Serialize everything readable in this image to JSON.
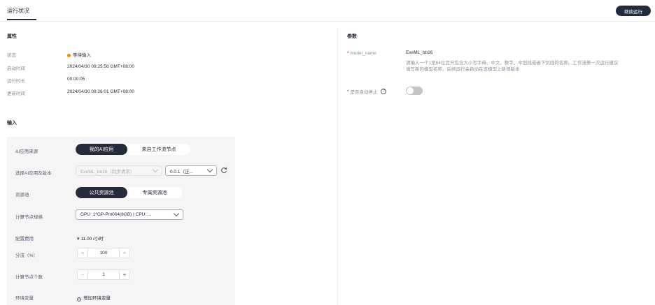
{
  "header": {
    "tab": "运行状况",
    "continue_button": "继续运行"
  },
  "properties": {
    "title": "属性",
    "rows": [
      {
        "label": "状态",
        "value": "等待输入"
      },
      {
        "label": "启动时间",
        "value": "2024/04/30 09:25:56 GMT+08:00"
      },
      {
        "label": "运行时长",
        "value": "00:00:05"
      },
      {
        "label": "更新时间",
        "value": "2024/04/30 09:26:01 GMT+08:00"
      }
    ],
    "status_color": "#ff8800"
  },
  "input": {
    "title": "输入",
    "ai_source": {
      "label": "AI应用来源",
      "options": [
        "我的AI应用",
        "来自工作流节点"
      ],
      "selected": "我的AI应用"
    },
    "app_version": {
      "label": "选择AI应用及版本",
      "app_value": "ExeML_bb16（同步请求）",
      "version_value": "0.0.1（正..."
    },
    "resource_pool": {
      "label": "资源池",
      "options": [
        "公共资源池",
        "专属资源池"
      ],
      "selected": "公共资源池"
    },
    "compute_spec": {
      "label": "计算节点规格",
      "value": "GPU: 1*GP-Pnt004(8GB) | CPU: ..."
    },
    "cost": {
      "label": "配置费用",
      "value": "¥ 11.00 /小时"
    },
    "traffic": {
      "label": "分流（%）",
      "value": "100",
      "minus": "−",
      "plus": "+"
    },
    "node_count": {
      "label": "计算节点个数",
      "value": "1",
      "minus": "−",
      "plus": "+"
    },
    "env": {
      "label": "环境变量",
      "add_label": "增加环境变量"
    }
  },
  "params": {
    "title": "参数",
    "model_name": {
      "label": "model_name",
      "value": "ExeML_bb16",
      "hint_line1": "请输入一个1至64位且只包含大小写字母、中文、数字、中划线或者下划线的名称。工作流第一次运行建议",
      "hint_line2": "填写新的模型名称，后续运行会自动在该模型上新增版本"
    },
    "auto_stop": {
      "label": "是否自动停止",
      "enabled": false
    }
  },
  "colors": {
    "primary_dark": "#252b3a",
    "required": "#e6000b"
  }
}
